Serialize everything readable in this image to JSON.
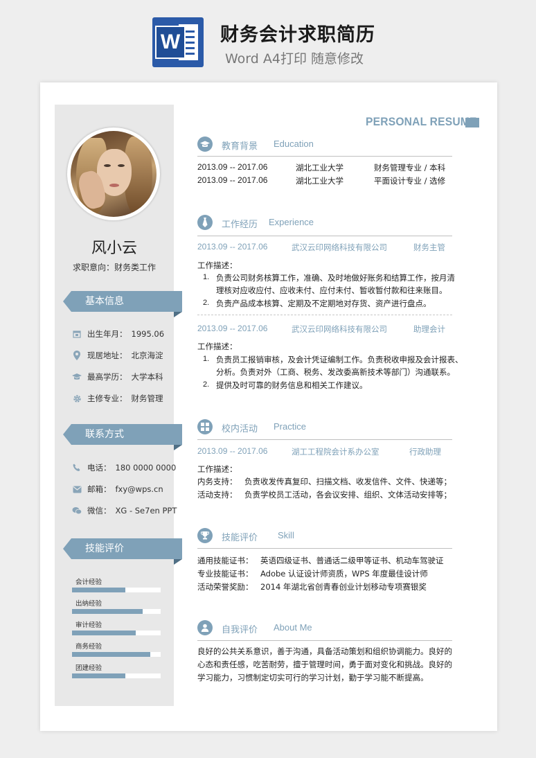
{
  "header": {
    "title": "财务会计求职简历",
    "subtitle": "Word A4打印 随意修改",
    "logo_letter": "W"
  },
  "colors": {
    "accent": "#7fa1b8",
    "sidebar": "#e8e8e8",
    "accent_dark": "#4f6f85"
  },
  "profile": {
    "name": "风小云",
    "intent": "求职意向：财务类工作"
  },
  "basic": {
    "title": "基本信息",
    "items": [
      {
        "icon": "calendar-icon",
        "label": "出生年月：",
        "value": "1995.06"
      },
      {
        "icon": "location-icon",
        "label": "现居地址：",
        "value": "北京海淀"
      },
      {
        "icon": "graduation-cap-icon",
        "label": "最高学历：",
        "value": "大学本科"
      },
      {
        "icon": "gear-icon",
        "label": "主修专业：",
        "value": "财务管理"
      }
    ]
  },
  "contact": {
    "title": "联系方式",
    "items": [
      {
        "icon": "phone-icon",
        "label": "电话：",
        "value": "180 0000 0000"
      },
      {
        "icon": "mail-icon",
        "label": "邮箱：",
        "value": "fxy@wps.cn"
      },
      {
        "icon": "wechat-icon",
        "label": "微信：",
        "value": "XG - Se7en PPT"
      }
    ]
  },
  "skills": {
    "title": "技能评价",
    "items": [
      {
        "label": "会计经验",
        "level": 0.6
      },
      {
        "label": "出纳经验",
        "level": 0.8
      },
      {
        "label": "审计经验",
        "level": 0.72
      },
      {
        "label": "商务经验",
        "level": 0.88
      },
      {
        "label": "团建经验",
        "level": 0.6
      }
    ]
  },
  "resume_label": "PERSONAL RESUME",
  "education": {
    "cn": "教育背景",
    "en": "Education",
    "rows": [
      {
        "date": "2013.09 -- 2017.06",
        "school": "湖北工业大学",
        "major": "财务管理专业 / 本科"
      },
      {
        "date": "2013.09 -- 2017.06",
        "school": "湖北工业大学",
        "major": "平面设计专业 / 选修"
      }
    ]
  },
  "experience": {
    "cn": "工作经历",
    "en": "Experience",
    "jobs": [
      {
        "date": "2013.09 -- 2017.06",
        "company": "武汉云印网络科技有限公司",
        "role": "财务主管",
        "desc_label": "工作描述：",
        "items": [
          {
            "num": "1.",
            "lines": [
              "负责公司财务核算工作，准确、及时地做好账务和结算工作，按月清",
              "理核对应收应付、应收未付、应付未付、暂收暂付款和往来账目。"
            ]
          },
          {
            "num": "2.",
            "lines": [
              "负责产品成本核算、定期及不定期地对存货、资产进行盘点。"
            ]
          }
        ]
      },
      {
        "date": "2013.09 -- 2017.06",
        "company": "武汉云印网络科技有限公司",
        "role": "助理会计",
        "desc_label": "工作描述：",
        "items": [
          {
            "num": "1.",
            "lines": [
              "负责员工报销审核，及会计凭证编制工作。负责税收申报及会计报表、",
              "分析。负责对外（工商、税务、发改委高新技术等部门）沟通联系。"
            ]
          },
          {
            "num": "2.",
            "lines": [
              "提供及时可靠的财务信息和相关工作建议。"
            ]
          }
        ]
      }
    ]
  },
  "practice": {
    "cn": "校内活动",
    "en": "Practice",
    "date": "2013.09 -- 2017.06",
    "org": "湖工工程院会计系办公室",
    "role": "行政助理",
    "desc_label": "工作描述：",
    "rows": [
      {
        "label": "内务支持：",
        "value": "负责收发传真复印、扫描文档、收发信件、文件、快递等；"
      },
      {
        "label": "活动支持：",
        "value": "负责学校员工活动，各会议安排、组织、文体活动安排等；"
      }
    ]
  },
  "skill_cert": {
    "cn": "技能评价",
    "en": "Skill",
    "rows": [
      {
        "label": "通用技能证书：",
        "value": "英语四级证书、普通话二级甲等证书、机动车驾驶证"
      },
      {
        "label": "专业技能证书：",
        "value": "Adobe 认证设计师资质，WPS 年度最佳设计师"
      },
      {
        "label": "活动荣誉奖励：",
        "value": "2014 年湖北省创青春创业计划移动专项赛银奖"
      }
    ]
  },
  "about": {
    "cn": "自我评价",
    "en": "About Me",
    "lines": [
      "良好的公共关系意识，善于沟通，具备活动策划和组织协调能力。良好的",
      "心态和责任感，吃苦耐劳，擅于管理时间，勇于面对变化和挑战。良好的",
      "学习能力，习惯制定切实可行的学习计划，勤于学习能不断提高。"
    ]
  }
}
